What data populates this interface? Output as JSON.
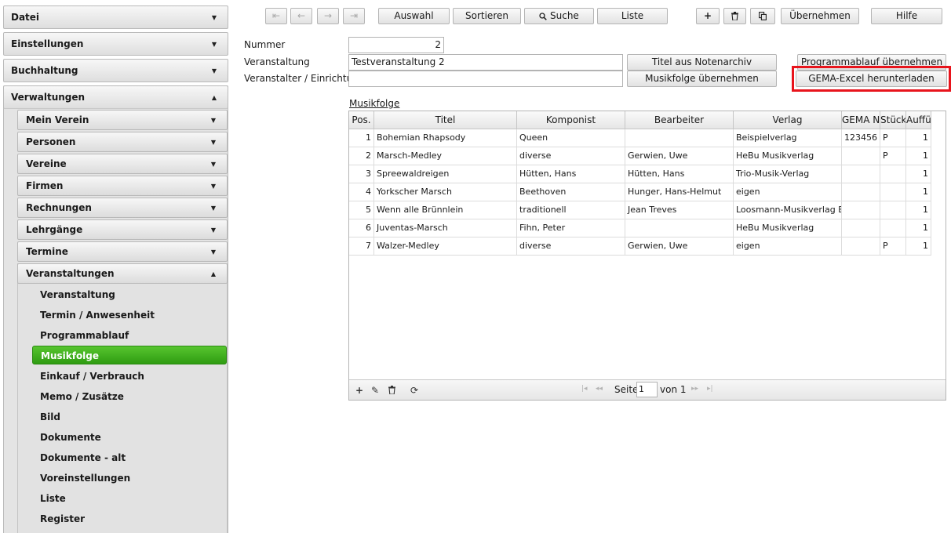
{
  "sidebar": {
    "sections": [
      {
        "label": "Datei"
      },
      {
        "label": "Einstellungen"
      },
      {
        "label": "Buchhaltung"
      },
      {
        "label": "Verwaltungen"
      }
    ],
    "sub_sections": [
      {
        "label": "Mein Verein"
      },
      {
        "label": "Personen"
      },
      {
        "label": "Vereine"
      },
      {
        "label": "Firmen"
      },
      {
        "label": "Rechnungen"
      },
      {
        "label": "Lehrgänge"
      },
      {
        "label": "Termine"
      },
      {
        "label": "Veranstaltungen"
      }
    ],
    "items": [
      {
        "label": "Veranstaltung"
      },
      {
        "label": "Termin / Anwesenheit"
      },
      {
        "label": "Programmablauf"
      },
      {
        "label": "Musikfolge",
        "active": true
      },
      {
        "label": "Einkauf / Verbrauch"
      },
      {
        "label": "Memo / Zusätze"
      },
      {
        "label": "Bild"
      },
      {
        "label": "Dokumente"
      },
      {
        "label": "Dokumente - alt"
      },
      {
        "label": "Voreinstellungen"
      },
      {
        "label": "Liste"
      },
      {
        "label": "Register"
      }
    ],
    "active_color": "#3daf1c"
  },
  "toolbar": {
    "auswahl": "Auswahl",
    "sortieren": "Sortieren",
    "suche": "Suche",
    "liste": "Liste",
    "uebernehmen": "Übernehmen",
    "hilfe": "Hilfe"
  },
  "form": {
    "nummer_label": "Nummer",
    "nummer_value": "2",
    "veranstaltung_label": "Veranstaltung",
    "veranstaltung_value": "Testveranstaltung 2",
    "veranstalter_label": "Veranstalter / Einrichtung",
    "veranstalter_value": "",
    "btn_titel_notenarchiv": "Titel aus Notenarchiv",
    "btn_musikfolge_uebernehmen": "Musikfolge übernehmen",
    "btn_programmablauf_uebernehmen": "Programmablauf übernehmen",
    "btn_gema_excel": "GEMA-Excel herunterladen",
    "highlight_color": "#e8141c"
  },
  "grid": {
    "title": "Musikfolge",
    "columns": [
      "Pos.",
      "Titel",
      "Komponist",
      "Bearbeiter",
      "Verlag",
      "GEMA N",
      "Stück",
      "Auffü"
    ],
    "rows": [
      [
        "1",
        "Bohemian Rhapsody",
        "Queen",
        "",
        "Beispielverlag",
        "123456",
        "P",
        "1"
      ],
      [
        "2",
        "Marsch-Medley",
        "diverse",
        "Gerwien, Uwe",
        "HeBu Musikverlag",
        "",
        "P",
        "1"
      ],
      [
        "3",
        "Spreewaldreigen",
        "Hütten, Hans",
        "Hütten, Hans",
        "Trio-Musik-Verlag",
        "",
        "",
        "1"
      ],
      [
        "4",
        "Yorkscher Marsch",
        "Beethoven",
        "Hunger, Hans-Helmut",
        "eigen",
        "",
        "",
        "1"
      ],
      [
        "5",
        "Wenn alle Brünnlein",
        "traditionell",
        "Jean Treves",
        "Loosmann-Musikverlag Ett",
        "",
        "",
        "1"
      ],
      [
        "6",
        "Juventas-Marsch",
        "Fihn, Peter",
        "",
        "HeBu Musikverlag",
        "",
        "",
        "1"
      ],
      [
        "7",
        "Walzer-Medley",
        "diverse",
        "Gerwien, Uwe",
        "eigen",
        "",
        "P",
        "1"
      ]
    ],
    "footer": {
      "seite_label": "Seite",
      "page_value": "1",
      "von_label": "von 1"
    }
  }
}
